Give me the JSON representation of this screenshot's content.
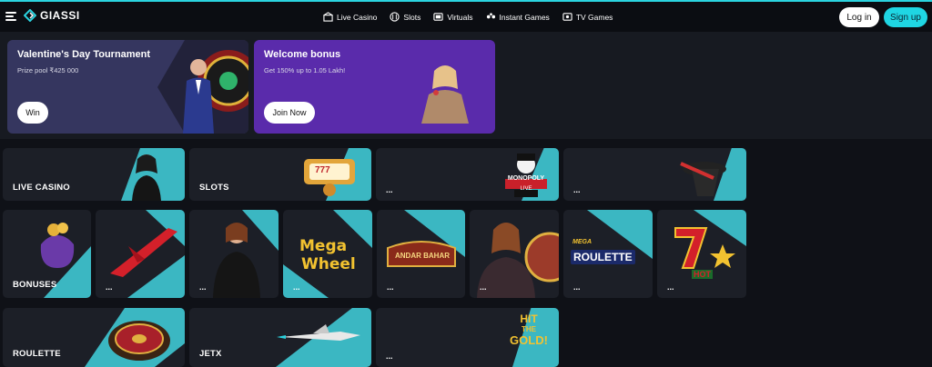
{
  "header": {
    "logo_text": "GIASSI",
    "nav": [
      {
        "label": "Live Casino",
        "icon": "live-casino-icon"
      },
      {
        "label": "Slots",
        "icon": "slots-icon"
      },
      {
        "label": "Virtuals",
        "icon": "virtuals-icon"
      },
      {
        "label": "Instant Games",
        "icon": "instant-games-icon"
      },
      {
        "label": "TV Games",
        "icon": "tv-games-icon"
      }
    ],
    "login_label": "Log in",
    "signup_label": "Sign up"
  },
  "promos": [
    {
      "title": "Valentine's Day Tournament",
      "subtitle": "Prize pool ₹425 000",
      "button": "Win"
    },
    {
      "title": "Welcome bonus",
      "subtitle": "Get 150% up to 1.05 Lakh!",
      "button": "Join Now"
    }
  ],
  "tiles": {
    "live_casino": "LIVE CASINO",
    "slots": "SLOTS",
    "bonuses": "BONUSES",
    "roulette": "ROULETTE",
    "jetx": "JETX",
    "more": "...",
    "monopoly_logo": "MONOPOLY",
    "monopoly_live": "LIVE",
    "mega_wheel_1": "Mega",
    "mega_wheel_2": "Wheel",
    "andar_bahar": "ANDAR BAHAR",
    "mega_fire_blaze": "MEGA",
    "roulette_logo": "ROULETTE",
    "hot_text": "HOT",
    "hit_the_gold_1": "HIT",
    "hit_the_gold_2": "THE",
    "hit_the_gold_3": "GOLD!",
    "slot_sevens": "777"
  },
  "colors": {
    "accent": "#1fd6e3",
    "promo1": "#35365f",
    "promo2": "#5a2bab",
    "tile": "#1c1f27"
  }
}
